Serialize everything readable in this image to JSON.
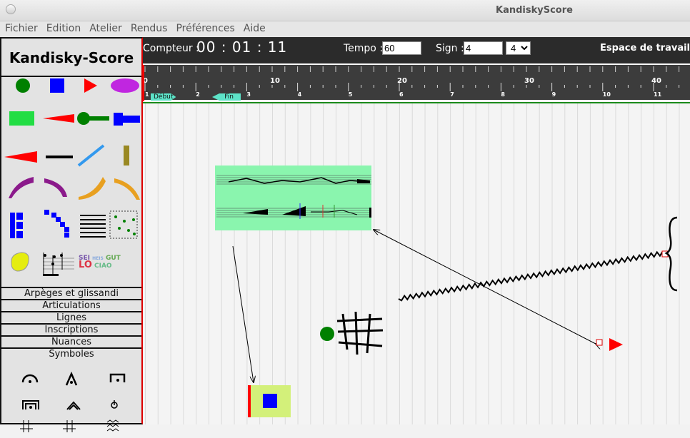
{
  "window": {
    "title": "KandiskyScore"
  },
  "menu": [
    "Fichier",
    "Edition",
    "Atelier",
    "Rendus",
    "Préférences",
    "Aide"
  ],
  "sidebar": {
    "logo": "Kandisky-Score",
    "categories": [
      "Arpèges et glissandi",
      "Articulations",
      "Lignes",
      "Inscriptions",
      "Nuances",
      "Symboles"
    ],
    "inscription_words": [
      "SEI",
      "HEIS",
      "GUT",
      "LO",
      "CIAO"
    ]
  },
  "toolbar": {
    "counter_label": "Compteur :",
    "counter_value": "00 : 01 : 11",
    "tempo_label": "Tempo :",
    "tempo_value": "60",
    "sign_label": "Sign :",
    "sign_value": "4",
    "sign_select": "4",
    "workspace_label": "Espace de travail"
  },
  "ruler": {
    "seconds_labels": [
      "0",
      "10",
      "20",
      "30",
      "40"
    ],
    "measure_labels": [
      "1",
      "2",
      "3",
      "4",
      "5",
      "6",
      "7",
      "8",
      "9",
      "10",
      "11"
    ],
    "start_marker": "Début",
    "end_marker": "Fin"
  },
  "colors": {
    "accent": "#ff0000",
    "green": "#008000",
    "blue": "#0000ff",
    "purple": "#c026e0",
    "score_bg": "#8af5ae"
  }
}
